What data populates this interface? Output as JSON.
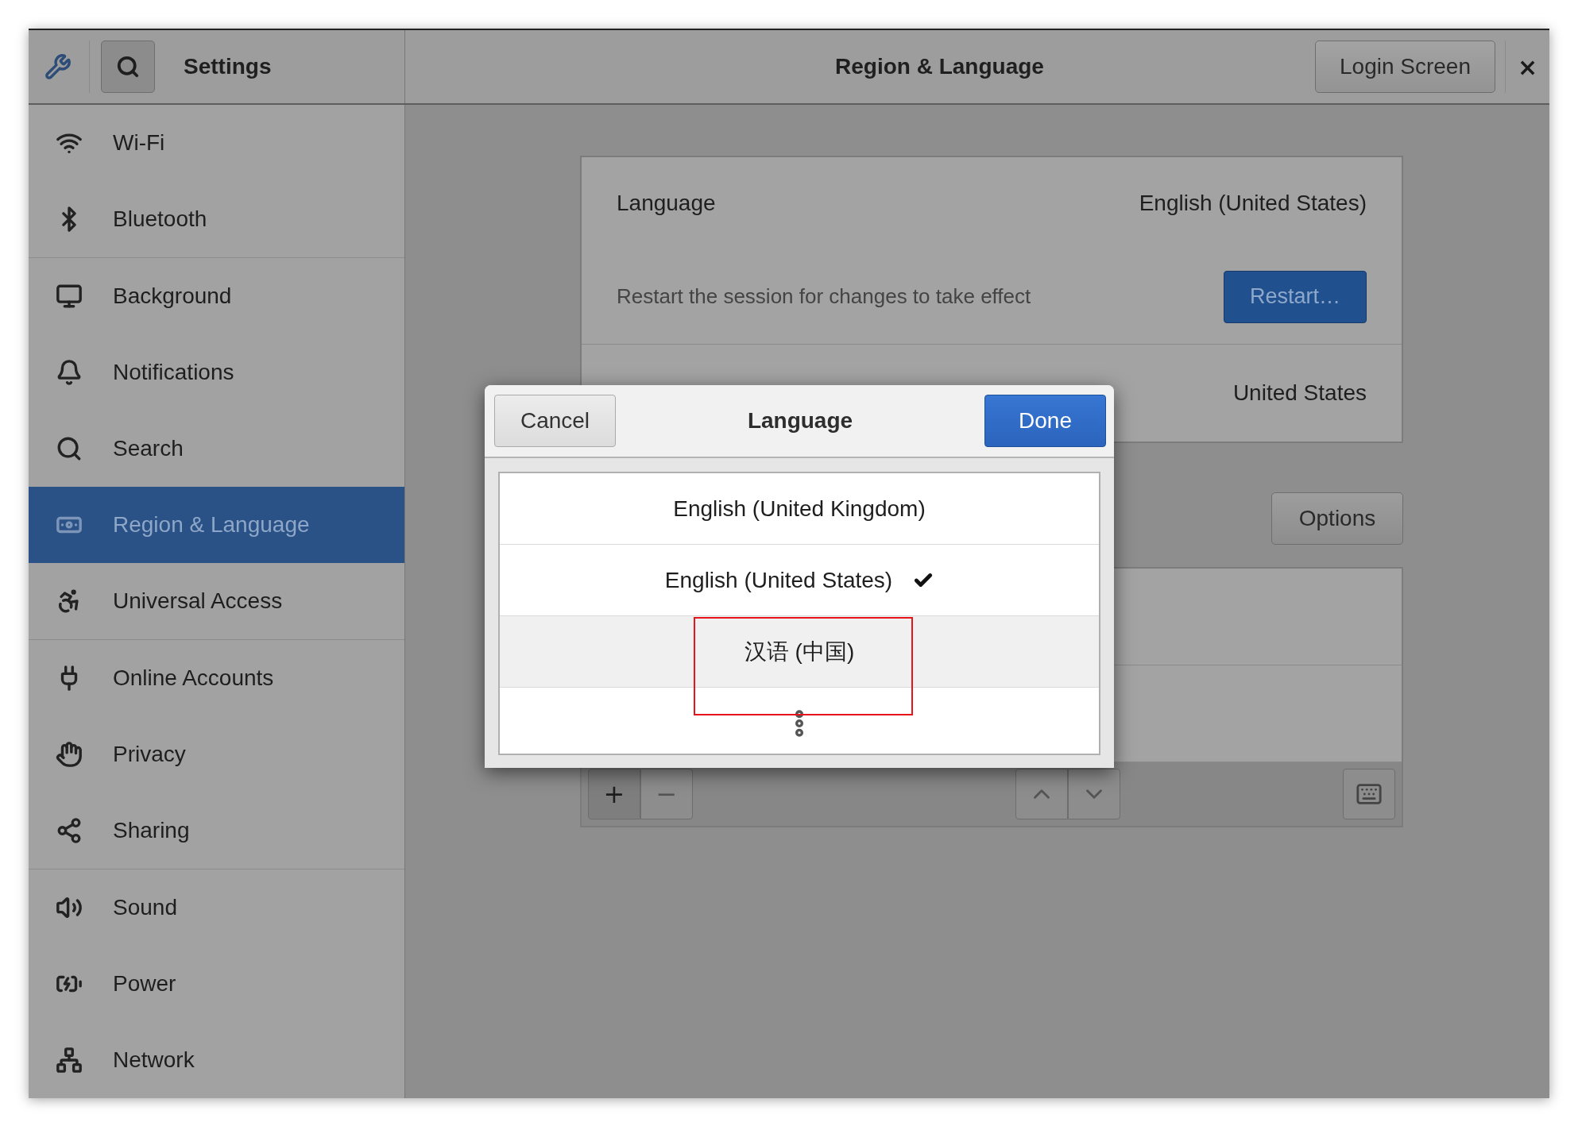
{
  "header": {
    "title": "Settings",
    "page_title": "Region & Language",
    "login_button": "Login Screen",
    "close": "×"
  },
  "sidebar": {
    "groups": [
      [
        {
          "label": "Wi-Fi",
          "selected": false
        },
        {
          "label": "Bluetooth",
          "selected": false
        }
      ],
      [
        {
          "label": "Background",
          "selected": false
        },
        {
          "label": "Notifications",
          "selected": false
        },
        {
          "label": "Search",
          "selected": false
        },
        {
          "label": "Region & Language",
          "selected": true
        },
        {
          "label": "Universal Access",
          "selected": false
        }
      ],
      [
        {
          "label": "Online Accounts",
          "selected": false
        },
        {
          "label": "Privacy",
          "selected": false
        },
        {
          "label": "Sharing",
          "selected": false
        }
      ],
      [
        {
          "label": "Sound",
          "selected": false
        },
        {
          "label": "Power",
          "selected": false
        },
        {
          "label": "Network",
          "selected": false
        }
      ]
    ]
  },
  "region": {
    "language_label": "Language",
    "language_value": "English (United States)",
    "restart_message": "Restart the session for changes to take effect",
    "restart_button": "Restart…",
    "formats_value": "United States",
    "options_button": "Options",
    "add_button": "+",
    "remove_button": "−"
  },
  "dialog": {
    "cancel": "Cancel",
    "title": "Language",
    "done": "Done",
    "languages": [
      {
        "label": "English (United Kingdom)",
        "checked": false,
        "highlighted": false
      },
      {
        "label": "English (United States)",
        "checked": true,
        "highlighted": false
      },
      {
        "label": "汉语 (中国)",
        "checked": false,
        "highlighted": true
      }
    ]
  }
}
